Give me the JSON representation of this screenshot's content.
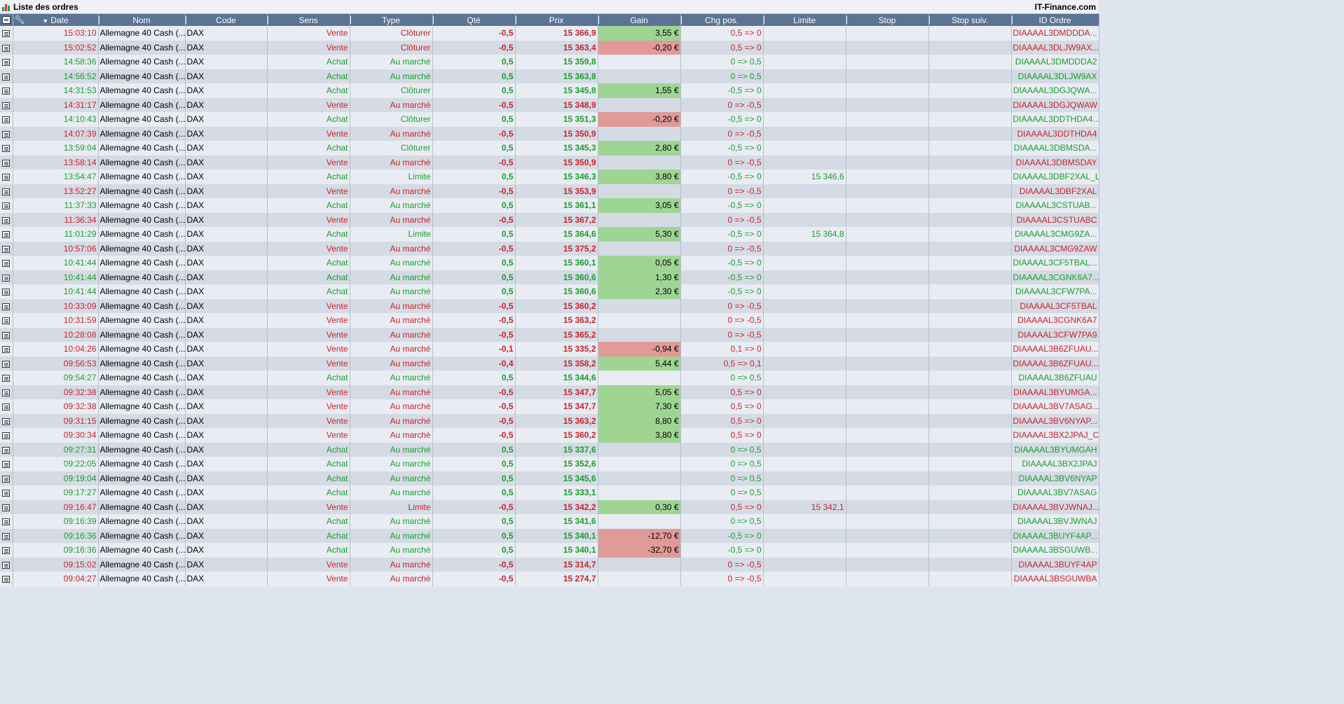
{
  "window": {
    "title": "Liste des ordres",
    "brand": "IT-Finance.com"
  },
  "columns": {
    "date": "Date",
    "nom": "Nom",
    "code": "Code",
    "sens": "Sens",
    "type": "Type",
    "qte": "Qté",
    "prix": "Prix",
    "gain": "Gain",
    "chg": "Chg pos.",
    "limite": "Limite",
    "stop": "Stop",
    "stopsuiv": "Stop suiv.",
    "id": "ID Ordre"
  },
  "colors": {
    "buy": "#1a9d2e",
    "sell": "#c8232c",
    "gain_positive_bg": "#9ed593",
    "gain_negative_bg": "#e09a98",
    "header_bg": "#5b7493"
  },
  "orders": [
    {
      "date": "15:03:10",
      "nom": "Allemagne 40 Cash (...",
      "code": "DAX",
      "sens": "Vente",
      "type": "Clôturer",
      "qte": "-0,5",
      "prix": "15 366,9",
      "gain": "3,55 €",
      "gain_sign": "pos",
      "chg": "0,5 => 0",
      "limite": "",
      "stop": "",
      "stopsuiv": "",
      "id": "DIAAAAL3DMDDDA..."
    },
    {
      "date": "15:02:52",
      "nom": "Allemagne 40 Cash (...",
      "code": "DAX",
      "sens": "Vente",
      "type": "Clôturer",
      "qte": "-0,5",
      "prix": "15 363,4",
      "gain": "-0,20 €",
      "gain_sign": "neg",
      "chg": "0,5 => 0",
      "limite": "",
      "stop": "",
      "stopsuiv": "",
      "id": "DIAAAAL3DLJW9AX..."
    },
    {
      "date": "14:58:36",
      "nom": "Allemagne 40 Cash (...",
      "code": "DAX",
      "sens": "Achat",
      "type": "Au marché",
      "qte": "0,5",
      "prix": "15 359,8",
      "gain": "",
      "gain_sign": "",
      "chg": "0 => 0,5",
      "limite": "",
      "stop": "",
      "stopsuiv": "",
      "id": "DIAAAAL3DMDDDA2"
    },
    {
      "date": "14:56:52",
      "nom": "Allemagne 40 Cash (...",
      "code": "DAX",
      "sens": "Achat",
      "type": "Au marché",
      "qte": "0,5",
      "prix": "15 363,8",
      "gain": "",
      "gain_sign": "",
      "chg": "0 => 0,5",
      "limite": "",
      "stop": "",
      "stopsuiv": "",
      "id": "DIAAAAL3DLJW9AX"
    },
    {
      "date": "14:31:53",
      "nom": "Allemagne 40 Cash (...",
      "code": "DAX",
      "sens": "Achat",
      "type": "Clôturer",
      "qte": "0,5",
      "prix": "15 345,8",
      "gain": "1,55 €",
      "gain_sign": "pos",
      "chg": "-0,5 => 0",
      "limite": "",
      "stop": "",
      "stopsuiv": "",
      "id": "DIAAAAL3DGJQWA..."
    },
    {
      "date": "14:31:17",
      "nom": "Allemagne 40 Cash (...",
      "code": "DAX",
      "sens": "Vente",
      "type": "Au marché",
      "qte": "-0,5",
      "prix": "15 348,9",
      "gain": "",
      "gain_sign": "",
      "chg": "0 => -0,5",
      "limite": "",
      "stop": "",
      "stopsuiv": "",
      "id": "DIAAAAL3DGJQWAW"
    },
    {
      "date": "14:10:43",
      "nom": "Allemagne 40 Cash (...",
      "code": "DAX",
      "sens": "Achat",
      "type": "Clôturer",
      "qte": "0,5",
      "prix": "15 351,3",
      "gain": "-0,20 €",
      "gain_sign": "neg",
      "chg": "-0,5 => 0",
      "limite": "",
      "stop": "",
      "stopsuiv": "",
      "id": "DIAAAAL3DDTHDA4..."
    },
    {
      "date": "14:07:39",
      "nom": "Allemagne 40 Cash (...",
      "code": "DAX",
      "sens": "Vente",
      "type": "Au marché",
      "qte": "-0,5",
      "prix": "15 350,9",
      "gain": "",
      "gain_sign": "",
      "chg": "0 => -0,5",
      "limite": "",
      "stop": "",
      "stopsuiv": "",
      "id": "DIAAAAL3DDTHDA4"
    },
    {
      "date": "13:59:04",
      "nom": "Allemagne 40 Cash (...",
      "code": "DAX",
      "sens": "Achat",
      "type": "Clôturer",
      "qte": "0,5",
      "prix": "15 345,3",
      "gain": "2,80 €",
      "gain_sign": "pos",
      "chg": "-0,5 => 0",
      "limite": "",
      "stop": "",
      "stopsuiv": "",
      "id": "DIAAAAL3DBMSDA..."
    },
    {
      "date": "13:58:14",
      "nom": "Allemagne 40 Cash (...",
      "code": "DAX",
      "sens": "Vente",
      "type": "Au marché",
      "qte": "-0,5",
      "prix": "15 350,9",
      "gain": "",
      "gain_sign": "",
      "chg": "0 => -0,5",
      "limite": "",
      "stop": "",
      "stopsuiv": "",
      "id": "DIAAAAL3DBMSDAY"
    },
    {
      "date": "13:54:47",
      "nom": "Allemagne 40 Cash (...",
      "code": "DAX",
      "sens": "Achat",
      "type": "Limite",
      "qte": "0,5",
      "prix": "15 346,3",
      "gain": "3,80 €",
      "gain_sign": "pos",
      "chg": "-0,5 => 0",
      "limite": "15 346,6",
      "stop": "",
      "stopsuiv": "",
      "id": "DIAAAAL3DBF2XAL_L"
    },
    {
      "date": "13:52:27",
      "nom": "Allemagne 40 Cash (...",
      "code": "DAX",
      "sens": "Vente",
      "type": "Au marché",
      "qte": "-0,5",
      "prix": "15 353,9",
      "gain": "",
      "gain_sign": "",
      "chg": "0 => -0,5",
      "limite": "",
      "stop": "",
      "stopsuiv": "",
      "id": "DIAAAAL3DBF2XAL"
    },
    {
      "date": "11:37:33",
      "nom": "Allemagne 40 Cash (...",
      "code": "DAX",
      "sens": "Achat",
      "type": "Au marché",
      "qte": "0,5",
      "prix": "15 361,1",
      "gain": "3,05 €",
      "gain_sign": "pos",
      "chg": "-0,5 => 0",
      "limite": "",
      "stop": "",
      "stopsuiv": "",
      "id": "DIAAAAL3CSTUAB..."
    },
    {
      "date": "11:36:34",
      "nom": "Allemagne 40 Cash (...",
      "code": "DAX",
      "sens": "Vente",
      "type": "Au marché",
      "qte": "-0,5",
      "prix": "15 367,2",
      "gain": "",
      "gain_sign": "",
      "chg": "0 => -0,5",
      "limite": "",
      "stop": "",
      "stopsuiv": "",
      "id": "DIAAAAL3CSTUABC"
    },
    {
      "date": "11:01:29",
      "nom": "Allemagne 40 Cash (...",
      "code": "DAX",
      "sens": "Achat",
      "type": "Limite",
      "qte": "0,5",
      "prix": "15 364,6",
      "gain": "5,30 €",
      "gain_sign": "pos",
      "chg": "-0,5 => 0",
      "limite": "15 364,8",
      "stop": "",
      "stopsuiv": "",
      "id": "DIAAAAL3CMG9ZA..."
    },
    {
      "date": "10:57:06",
      "nom": "Allemagne 40 Cash (...",
      "code": "DAX",
      "sens": "Vente",
      "type": "Au marché",
      "qte": "-0,5",
      "prix": "15 375,2",
      "gain": "",
      "gain_sign": "",
      "chg": "0 => -0,5",
      "limite": "",
      "stop": "",
      "stopsuiv": "",
      "id": "DIAAAAL3CMG9ZAW"
    },
    {
      "date": "10:41:44",
      "nom": "Allemagne 40 Cash (...",
      "code": "DAX",
      "sens": "Achat",
      "type": "Au marché",
      "qte": "0,5",
      "prix": "15 360,1",
      "gain": "0,05 €",
      "gain_sign": "pos",
      "chg": "-0,5 => 0",
      "limite": "",
      "stop": "",
      "stopsuiv": "",
      "id": "DIAAAAL3CF5TBAL..."
    },
    {
      "date": "10:41:44",
      "nom": "Allemagne 40 Cash (...",
      "code": "DAX",
      "sens": "Achat",
      "type": "Au marché",
      "qte": "0,5",
      "prix": "15 360,6",
      "gain": "1,30 €",
      "gain_sign": "pos",
      "chg": "-0,5 => 0",
      "limite": "",
      "stop": "",
      "stopsuiv": "",
      "id": "DIAAAAL3CGNK6A7..."
    },
    {
      "date": "10:41:44",
      "nom": "Allemagne 40 Cash (...",
      "code": "DAX",
      "sens": "Achat",
      "type": "Au marché",
      "qte": "0,5",
      "prix": "15 360,6",
      "gain": "2,30 €",
      "gain_sign": "pos",
      "chg": "-0,5 => 0",
      "limite": "",
      "stop": "",
      "stopsuiv": "",
      "id": "DIAAAAL3CFW7PA..."
    },
    {
      "date": "10:33:09",
      "nom": "Allemagne 40 Cash (...",
      "code": "DAX",
      "sens": "Vente",
      "type": "Au marché",
      "qte": "-0,5",
      "prix": "15 360,2",
      "gain": "",
      "gain_sign": "",
      "chg": "0 => -0,5",
      "limite": "",
      "stop": "",
      "stopsuiv": "",
      "id": "DIAAAAL3CF5TBAL"
    },
    {
      "date": "10:31:59",
      "nom": "Allemagne 40 Cash (...",
      "code": "DAX",
      "sens": "Vente",
      "type": "Au marché",
      "qte": "-0,5",
      "prix": "15 363,2",
      "gain": "",
      "gain_sign": "",
      "chg": "0 => -0,5",
      "limite": "",
      "stop": "",
      "stopsuiv": "",
      "id": "DIAAAAL3CGNK6A7"
    },
    {
      "date": "10:28:08",
      "nom": "Allemagne 40 Cash (...",
      "code": "DAX",
      "sens": "Vente",
      "type": "Au marché",
      "qte": "-0,5",
      "prix": "15 365,2",
      "gain": "",
      "gain_sign": "",
      "chg": "0 => -0,5",
      "limite": "",
      "stop": "",
      "stopsuiv": "",
      "id": "DIAAAAL3CFW7PA9"
    },
    {
      "date": "10:04:26",
      "nom": "Allemagne 40 Cash (...",
      "code": "DAX",
      "sens": "Vente",
      "type": "Au marché",
      "qte": "-0,1",
      "prix": "15 335,2",
      "gain": "-0,94 €",
      "gain_sign": "neg",
      "chg": "0,1 => 0",
      "limite": "",
      "stop": "",
      "stopsuiv": "",
      "id": "DIAAAAL3B6ZFUAU..."
    },
    {
      "date": "09:56:53",
      "nom": "Allemagne 40 Cash (...",
      "code": "DAX",
      "sens": "Vente",
      "type": "Au marché",
      "qte": "-0,4",
      "prix": "15 358,2",
      "gain": "5,44 €",
      "gain_sign": "pos",
      "chg": "0,5 => 0,1",
      "limite": "",
      "stop": "",
      "stopsuiv": "",
      "id": "DIAAAAL3B6ZFUAU..."
    },
    {
      "date": "09:54:27",
      "nom": "Allemagne 40 Cash (...",
      "code": "DAX",
      "sens": "Achat",
      "type": "Au marché",
      "qte": "0,5",
      "prix": "15 344,6",
      "gain": "",
      "gain_sign": "",
      "chg": "0 => 0,5",
      "limite": "",
      "stop": "",
      "stopsuiv": "",
      "id": "DIAAAAL3B6ZFUAU"
    },
    {
      "date": "09:32:38",
      "nom": "Allemagne 40 Cash (...",
      "code": "DAX",
      "sens": "Vente",
      "type": "Au marché",
      "qte": "-0,5",
      "prix": "15 347,7",
      "gain": "5,05 €",
      "gain_sign": "pos",
      "chg": "0,5 => 0",
      "limite": "",
      "stop": "",
      "stopsuiv": "",
      "id": "DIAAAAL3BYUMGA..."
    },
    {
      "date": "09:32:38",
      "nom": "Allemagne 40 Cash (...",
      "code": "DAX",
      "sens": "Vente",
      "type": "Au marché",
      "qte": "-0,5",
      "prix": "15 347,7",
      "gain": "7,30 €",
      "gain_sign": "pos",
      "chg": "0,5 => 0",
      "limite": "",
      "stop": "",
      "stopsuiv": "",
      "id": "DIAAAAL3BV7ASAG..."
    },
    {
      "date": "09:31:15",
      "nom": "Allemagne 40 Cash (...",
      "code": "DAX",
      "sens": "Vente",
      "type": "Au marché",
      "qte": "-0,5",
      "prix": "15 363,2",
      "gain": "8,80 €",
      "gain_sign": "pos",
      "chg": "0,5 => 0",
      "limite": "",
      "stop": "",
      "stopsuiv": "",
      "id": "DIAAAAL3BV6NYAP..."
    },
    {
      "date": "09:30:34",
      "nom": "Allemagne 40 Cash (...",
      "code": "DAX",
      "sens": "Vente",
      "type": "Au marché",
      "qte": "-0,5",
      "prix": "15 360,2",
      "gain": "3,80 €",
      "gain_sign": "pos",
      "chg": "0,5 => 0",
      "limite": "",
      "stop": "",
      "stopsuiv": "",
      "id": "DIAAAAL3BX2JPAJ_C"
    },
    {
      "date": "09:27:31",
      "nom": "Allemagne 40 Cash (...",
      "code": "DAX",
      "sens": "Achat",
      "type": "Au marché",
      "qte": "0,5",
      "prix": "15 337,6",
      "gain": "",
      "gain_sign": "",
      "chg": "0 => 0,5",
      "limite": "",
      "stop": "",
      "stopsuiv": "",
      "id": "DIAAAAL3BYUMGAH"
    },
    {
      "date": "09:22:05",
      "nom": "Allemagne 40 Cash (...",
      "code": "DAX",
      "sens": "Achat",
      "type": "Au marché",
      "qte": "0,5",
      "prix": "15 352,6",
      "gain": "",
      "gain_sign": "",
      "chg": "0 => 0,5",
      "limite": "",
      "stop": "",
      "stopsuiv": "",
      "id": "DIAAAAL3BX2JPAJ"
    },
    {
      "date": "09:19:04",
      "nom": "Allemagne 40 Cash (...",
      "code": "DAX",
      "sens": "Achat",
      "type": "Au marché",
      "qte": "0,5",
      "prix": "15 345,6",
      "gain": "",
      "gain_sign": "",
      "chg": "0 => 0,5",
      "limite": "",
      "stop": "",
      "stopsuiv": "",
      "id": "DIAAAAL3BV6NYAP"
    },
    {
      "date": "09:17:27",
      "nom": "Allemagne 40 Cash (...",
      "code": "DAX",
      "sens": "Achat",
      "type": "Au marché",
      "qte": "0,5",
      "prix": "15 333,1",
      "gain": "",
      "gain_sign": "",
      "chg": "0 => 0,5",
      "limite": "",
      "stop": "",
      "stopsuiv": "",
      "id": "DIAAAAL3BV7ASAG"
    },
    {
      "date": "09:16:47",
      "nom": "Allemagne 40 Cash (...",
      "code": "DAX",
      "sens": "Vente",
      "type": "Limite",
      "qte": "-0,5",
      "prix": "15 342,2",
      "gain": "0,30 €",
      "gain_sign": "pos",
      "chg": "0,5 => 0",
      "limite": "15 342,1",
      "stop": "",
      "stopsuiv": "",
      "id": "DIAAAAL3BVJWNAJ..."
    },
    {
      "date": "09:16:39",
      "nom": "Allemagne 40 Cash (...",
      "code": "DAX",
      "sens": "Achat",
      "type": "Au marché",
      "qte": "0,5",
      "prix": "15 341,6",
      "gain": "",
      "gain_sign": "",
      "chg": "0 => 0,5",
      "limite": "",
      "stop": "",
      "stopsuiv": "",
      "id": "DIAAAAL3BVJWNAJ"
    },
    {
      "date": "09:16:36",
      "nom": "Allemagne 40 Cash (...",
      "code": "DAX",
      "sens": "Achat",
      "type": "Au marché",
      "qte": "0,5",
      "prix": "15 340,1",
      "gain": "-12,70 €",
      "gain_sign": "neg",
      "chg": "-0,5 => 0",
      "limite": "",
      "stop": "",
      "stopsuiv": "",
      "id": "DIAAAAL3BUYF4AP..."
    },
    {
      "date": "09:16:36",
      "nom": "Allemagne 40 Cash (...",
      "code": "DAX",
      "sens": "Achat",
      "type": "Au marché",
      "qte": "0,5",
      "prix": "15 340,1",
      "gain": "-32,70 €",
      "gain_sign": "neg",
      "chg": "-0,5 => 0",
      "limite": "",
      "stop": "",
      "stopsuiv": "",
      "id": "DIAAAAL3BSGUWB..."
    },
    {
      "date": "09:15:02",
      "nom": "Allemagne 40 Cash (...",
      "code": "DAX",
      "sens": "Vente",
      "type": "Au marché",
      "qte": "-0,5",
      "prix": "15 314,7",
      "gain": "",
      "gain_sign": "",
      "chg": "0 => -0,5",
      "limite": "",
      "stop": "",
      "stopsuiv": "",
      "id": "DIAAAAL3BUYF4AP"
    },
    {
      "date": "09:04:27",
      "nom": "Allemagne 40 Cash (...",
      "code": "DAX",
      "sens": "Vente",
      "type": "Au marché",
      "qte": "-0,5",
      "prix": "15 274,7",
      "gain": "",
      "gain_sign": "",
      "chg": "0 => -0,5",
      "limite": "",
      "stop": "",
      "stopsuiv": "",
      "id": "DIAAAAL3BSGUWBA"
    }
  ]
}
